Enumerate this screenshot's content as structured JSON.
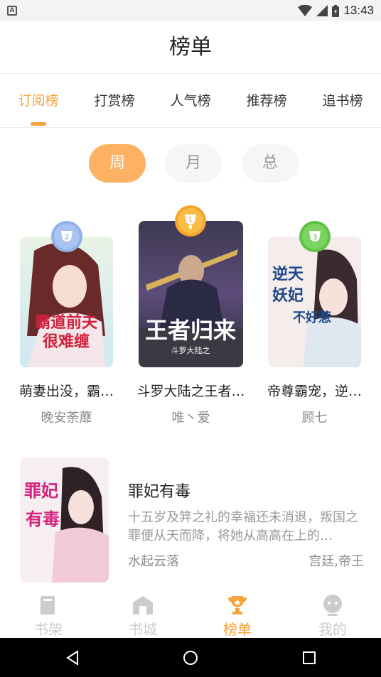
{
  "status_bar": {
    "time": "13:43",
    "left_icon": "A"
  },
  "header": {
    "title": "榜单"
  },
  "tabs": [
    {
      "label": "订阅榜",
      "active": true
    },
    {
      "label": "打赏榜",
      "active": false
    },
    {
      "label": "人气榜",
      "active": false
    },
    {
      "label": "推荐榜",
      "active": false
    },
    {
      "label": "追书榜",
      "active": false
    }
  ],
  "periods": [
    {
      "label": "周",
      "active": true
    },
    {
      "label": "月",
      "active": false
    },
    {
      "label": "总",
      "active": false
    }
  ],
  "podium": [
    {
      "rank": "2",
      "title": "萌妻出没，霸…",
      "author": "晚安荼蘼",
      "cover_text": "霸道前夫很难缠",
      "medal_color": "#8fb2ea"
    },
    {
      "rank": "1",
      "title": "斗罗大陆之王者…",
      "author": "唯丶爱",
      "cover_text": "王者归来",
      "cover_sub": "斗罗大陆之",
      "medal_color": "#f6a42c"
    },
    {
      "rank": "3",
      "title": "帝尊霸宠，逆…",
      "author": "顾七",
      "cover_text": "逆天妖妃不好惹",
      "medal_color": "#5fc247"
    }
  ],
  "list": [
    {
      "title": "罪妃有毒",
      "desc": "十五岁及笄之礼的幸福还未消退，叛国之罪便从天而降，将她从高高在上的…",
      "author": "水起云落",
      "tags": "宫廷,帝王",
      "cover_text": "罪妃有毒"
    }
  ],
  "bottom_nav": [
    {
      "label": "书架",
      "icon": "bookshelf-icon",
      "active": false
    },
    {
      "label": "书城",
      "icon": "bookstore-icon",
      "active": false
    },
    {
      "label": "榜单",
      "icon": "trophy-icon",
      "active": true
    },
    {
      "label": "我的",
      "icon": "profile-icon",
      "active": false
    }
  ],
  "colors": {
    "accent": "#f5a33d",
    "pill_active": "#fdb162"
  }
}
